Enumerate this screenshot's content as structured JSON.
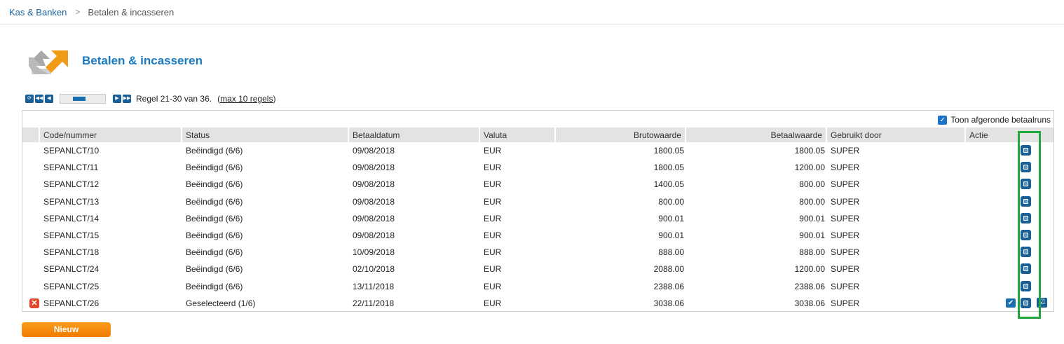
{
  "breadcrumb": {
    "parent": "Kas & Banken",
    "separator": ">",
    "current": "Betalen & incasseren"
  },
  "page": {
    "title": "Betalen & incasseren"
  },
  "pager": {
    "range_text": "Regel 21-30 van 36.",
    "max_prefix": "(",
    "max_link": "max 10 regels",
    "max_suffix": ")",
    "progress_fraction": 0.6
  },
  "toolbar": {
    "show_completed_label": "Toon afgeronde betaalruns",
    "show_completed_checked": true
  },
  "table": {
    "columns": [
      "Code/nummer",
      "Status",
      "Betaaldatum",
      "Valuta",
      "Brutowaarde",
      "Betaalwaarde",
      "Gebruikt door",
      "Actie"
    ],
    "rows": [
      {
        "code": "SEPANLCT/10",
        "status": "Beëindigd (6/6)",
        "date": "09/08/2018",
        "currency": "EUR",
        "gross": "1800.05",
        "paid": "1800.05",
        "user": "SUPER"
      },
      {
        "code": "SEPANLCT/11",
        "status": "Beëindigd (6/6)",
        "date": "09/08/2018",
        "currency": "EUR",
        "gross": "1800.05",
        "paid": "1200.00",
        "user": "SUPER"
      },
      {
        "code": "SEPANLCT/12",
        "status": "Beëindigd (6/6)",
        "date": "09/08/2018",
        "currency": "EUR",
        "gross": "1400.05",
        "paid": "800.00",
        "user": "SUPER"
      },
      {
        "code": "SEPANLCT/13",
        "status": "Beëindigd (6/6)",
        "date": "09/08/2018",
        "currency": "EUR",
        "gross": "800.00",
        "paid": "800.00",
        "user": "SUPER"
      },
      {
        "code": "SEPANLCT/14",
        "status": "Beëindigd (6/6)",
        "date": "09/08/2018",
        "currency": "EUR",
        "gross": "900.01",
        "paid": "900.01",
        "user": "SUPER"
      },
      {
        "code": "SEPANLCT/15",
        "status": "Beëindigd (6/6)",
        "date": "09/08/2018",
        "currency": "EUR",
        "gross": "900.01",
        "paid": "900.01",
        "user": "SUPER"
      },
      {
        "code": "SEPANLCT/18",
        "status": "Beëindigd (6/6)",
        "date": "10/09/2018",
        "currency": "EUR",
        "gross": "888.00",
        "paid": "888.00",
        "user": "SUPER"
      },
      {
        "code": "SEPANLCT/24",
        "status": "Beëindigd (6/6)",
        "date": "02/10/2018",
        "currency": "EUR",
        "gross": "2088.00",
        "paid": "1200.00",
        "user": "SUPER"
      },
      {
        "code": "SEPANLCT/25",
        "status": "Beëindigd (6/6)",
        "date": "13/11/2018",
        "currency": "EUR",
        "gross": "2388.06",
        "paid": "2388.06",
        "user": "SUPER"
      },
      {
        "code": "SEPANLCT/26",
        "status": "Geselecteerd (1/6)",
        "date": "22/11/2018",
        "currency": "EUR",
        "gross": "3038.06",
        "paid": "3038.06",
        "user": "SUPER",
        "deletable": true,
        "extra_actions": true
      }
    ]
  },
  "buttons": {
    "new_label": "Nieuw"
  },
  "colors": {
    "accent": "#1a7ac0",
    "button_orange": "#f58a07",
    "highlight": "#22a83a",
    "delete": "#e0472c"
  },
  "icons": {
    "page": "payment-arrows-icon",
    "pager": [
      "refresh-icon",
      "first-page-icon",
      "prev-page-icon",
      "next-page-icon",
      "last-page-icon"
    ],
    "row_actions": [
      "detail-icon",
      "confirm-icon",
      "approve-icon",
      "delete-icon"
    ]
  }
}
